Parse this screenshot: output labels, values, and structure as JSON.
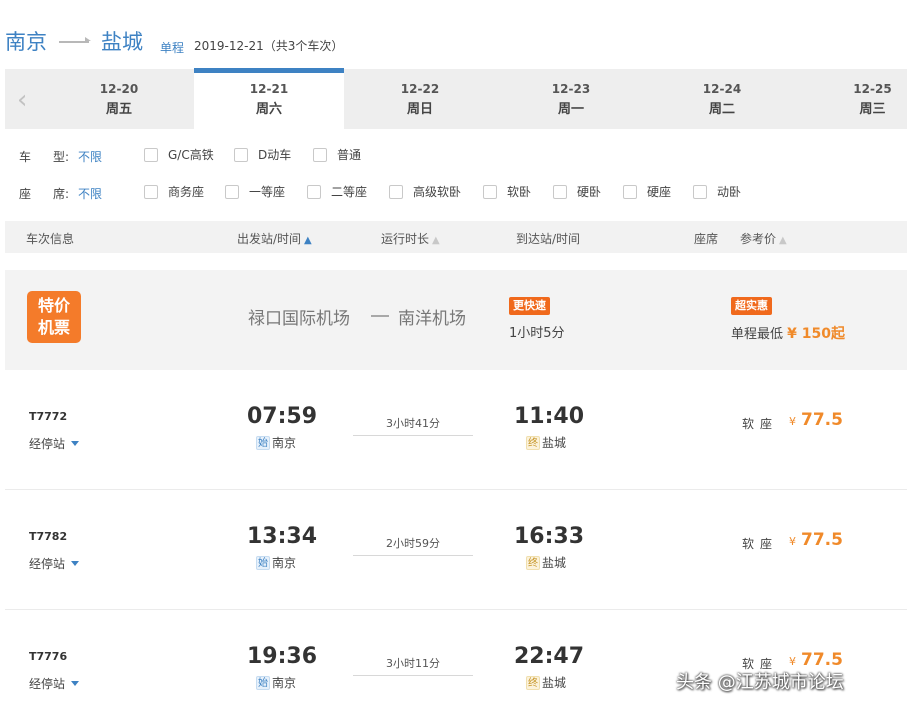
{
  "header": {
    "from_city": "南京",
    "to_city": "盐城",
    "trip_type": "单程",
    "date_summary": "2019-12-21（共3个车次）"
  },
  "date_tabs": [
    {
      "date": "12-20",
      "weekday": "周五",
      "active": false
    },
    {
      "date": "12-21",
      "weekday": "周六",
      "active": true
    },
    {
      "date": "12-22",
      "weekday": "周日",
      "active": false
    },
    {
      "date": "12-23",
      "weekday": "周一",
      "active": false
    },
    {
      "date": "12-24",
      "weekday": "周二",
      "active": false
    },
    {
      "date": "12-25",
      "weekday": "周三",
      "active": false
    }
  ],
  "filters": {
    "train_type": {
      "label_a": "车",
      "label_b": "型:",
      "value": "不限",
      "options": [
        "G/C高铁",
        "D动车",
        "普通"
      ]
    },
    "seat_type": {
      "label_a": "座",
      "label_b": "席:",
      "value": "不限",
      "options": [
        "商务座",
        "一等座",
        "二等座",
        "高级软卧",
        "软卧",
        "硬卧",
        "硬座",
        "动卧"
      ]
    }
  },
  "columns": {
    "train_info": "车次信息",
    "depart": "出发站/时间",
    "duration": "运行时长",
    "arrive": "到达站/时间",
    "seat": "座席",
    "price": "参考价"
  },
  "promo": {
    "badge_line1": "特价",
    "badge_line2": "机票",
    "from": "禄口国际机场",
    "to": "南洋机场",
    "faster_tag": "更快速",
    "duration": "1小时5分",
    "cheap_tag": "超实惠",
    "price_prefix": "单程最低",
    "price": "¥ 150起"
  },
  "trains": [
    {
      "number": "T7772",
      "stops_label": "经停站",
      "depart_time": "07:59",
      "start_icon": "始",
      "depart_station": "南京",
      "duration": "3小时41分",
      "arrive_time": "11:40",
      "end_icon": "终",
      "arrive_station": "盐城",
      "seat": "软座",
      "currency": "¥",
      "price": "77.5"
    },
    {
      "number": "T7782",
      "stops_label": "经停站",
      "depart_time": "13:34",
      "start_icon": "始",
      "depart_station": "南京",
      "duration": "2小时59分",
      "arrive_time": "16:33",
      "end_icon": "终",
      "arrive_station": "盐城",
      "seat": "软座",
      "currency": "¥",
      "price": "77.5"
    },
    {
      "number": "T7776",
      "stops_label": "经停站",
      "depart_time": "19:36",
      "start_icon": "始",
      "depart_station": "南京",
      "duration": "3小时11分",
      "arrive_time": "22:47",
      "end_icon": "终",
      "arrive_station": "盐城",
      "seat": "软座",
      "currency": "¥",
      "price": "77.5"
    }
  ],
  "watermark": "头条 @江苏城市论坛",
  "colors": {
    "accent": "#3e82c3",
    "price": "#f08a2a",
    "promo": "#f47b2a"
  }
}
